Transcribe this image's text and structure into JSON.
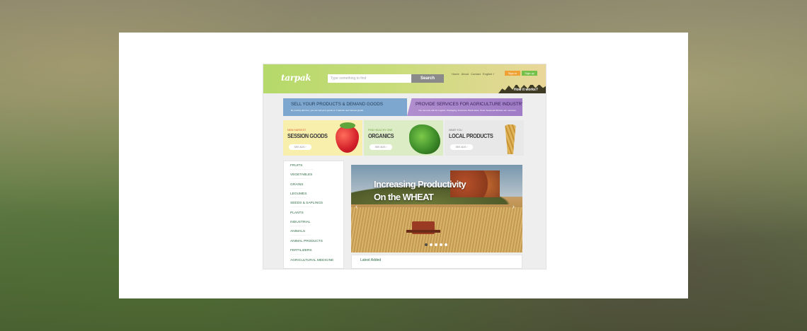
{
  "site": {
    "logo": "tarpak",
    "search": {
      "placeholder": "Type something to find",
      "button": "Search"
    },
    "nav": [
      "Home",
      "About",
      "Contact",
      "English ˅"
    ],
    "sign_in": "Sign in",
    "sign_up": "Sign up",
    "how_it_works": "How it works?"
  },
  "banners": {
    "left": {
      "title": "SELL YOUR PRODUCTS & DEMAND GOODS",
      "text": "By posting ads free, you can sell your goods or 1 website new harvest goods."
    },
    "right": {
      "title": "PROVIDE SERVICES FOR AGRICULTURE INDUSTRY",
      "text": "You can post ads for Logistic, Packaging, Insurance, Bank loans, Tools, Seasonal Workers etc. services."
    }
  },
  "cards": [
    {
      "eyebrow": "NEW HARVEST",
      "title": "SESSION GOODS",
      "button": "SEE ADS  ›"
    },
    {
      "eyebrow": "FIND HEALTHY ONE",
      "title": "ORGANICS",
      "button": "SEE ADS  ›"
    },
    {
      "eyebrow": "NEAR YOU",
      "title": "LOCAL PRODUCTS",
      "button": "SEE ADS  ›"
    }
  ],
  "categories": [
    "FRUITS",
    "VEGETABLES",
    "GRAINS",
    "LEGUMES",
    "SEEDS & SAPLINGS",
    "PLANTS",
    "INDUSTRIAL",
    "ANIMALS",
    "ANIMAL PRODUCTS",
    "FERTILIZERS",
    "AGRICULTURAL MEDICINE"
  ],
  "hero": {
    "line1": "Increasing Productivity",
    "line2": "On the WHEAT",
    "prev": "‹",
    "next": "›",
    "slide_count": 5,
    "active_slide": 0
  },
  "latest": {
    "label": "Latest Added"
  },
  "colors": {
    "header_start": "#b5d96a",
    "header_end": "#e9d79a",
    "sign_in": "#f0a133",
    "sign_up": "#75c048",
    "category_text": "#2f6b45"
  }
}
